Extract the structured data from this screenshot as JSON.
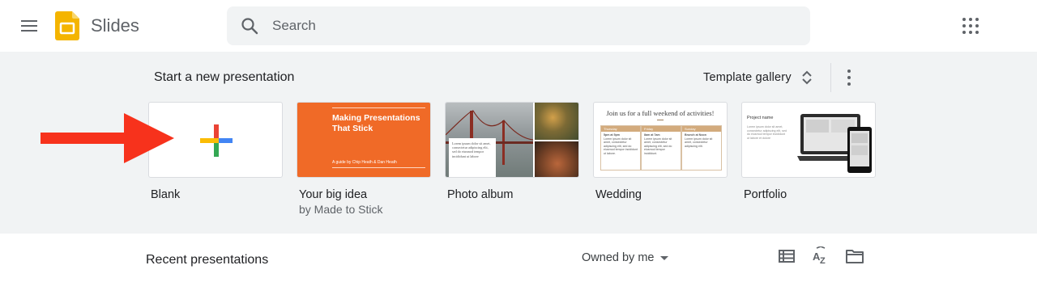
{
  "header": {
    "app_name": "Slides",
    "search_placeholder": "Search"
  },
  "templates": {
    "section_title": "Start a new presentation",
    "gallery_label": "Template gallery",
    "cards": [
      {
        "title": "Blank",
        "subtitle": ""
      },
      {
        "title": "Your big idea",
        "subtitle": "by Made to Stick"
      },
      {
        "title": "Photo album",
        "subtitle": ""
      },
      {
        "title": "Wedding",
        "subtitle": ""
      },
      {
        "title": "Portfolio",
        "subtitle": ""
      }
    ],
    "big_idea_thumb": {
      "title": "Making Presentations That Stick",
      "byline": "A guide by Chip Heath & Dan Heath"
    },
    "photo_album_thumb": {
      "caption": "Lorem ipsum dolor sit amet, consectetur adipiscing elit, sed do eiusmod tempor incididunt ut labore"
    },
    "wedding_thumb": {
      "title": "Join us for a full weekend of activities!",
      "columns": [
        {
          "day": "Thursday",
          "time": "5pm at 5pm",
          "text": "Lorem ipsum dolor sit amet, consectetur adipiscing elit, sed do eiusmod tempor incididunt ut labore."
        },
        {
          "day": "Friday",
          "time": "8am at 7am",
          "text": "Lorem ipsum dolor sit amet, consectetur adipiscing elit, sed do eiusmod tempor incididunt."
        },
        {
          "day": "Sunday",
          "time": "Brunch at Noon",
          "text": "Lorem ipsum dolor sit amet, consectetur adipiscing elit."
        }
      ]
    },
    "portfolio_thumb": {
      "name": "Project name",
      "text": "Lorem ipsum dolor sit amet, consectetur adipiscing elit, sed do eiusmod tempor incididunt ut labore et dolore"
    }
  },
  "recent": {
    "title": "Recent presentations",
    "owner_filter": "Owned by me"
  },
  "colors": {
    "accent_arrow": "#f7321c",
    "slides_yellow": "#f4b400",
    "section_bg": "#f1f3f4",
    "template_orange": "#f06a27"
  },
  "icons": [
    "menu-icon",
    "slides-logo-icon",
    "search-icon",
    "apps-grid-icon",
    "unfold-icon",
    "more-vert-icon",
    "plus-icon",
    "list-view-icon",
    "sort-az-icon",
    "folder-icon"
  ]
}
